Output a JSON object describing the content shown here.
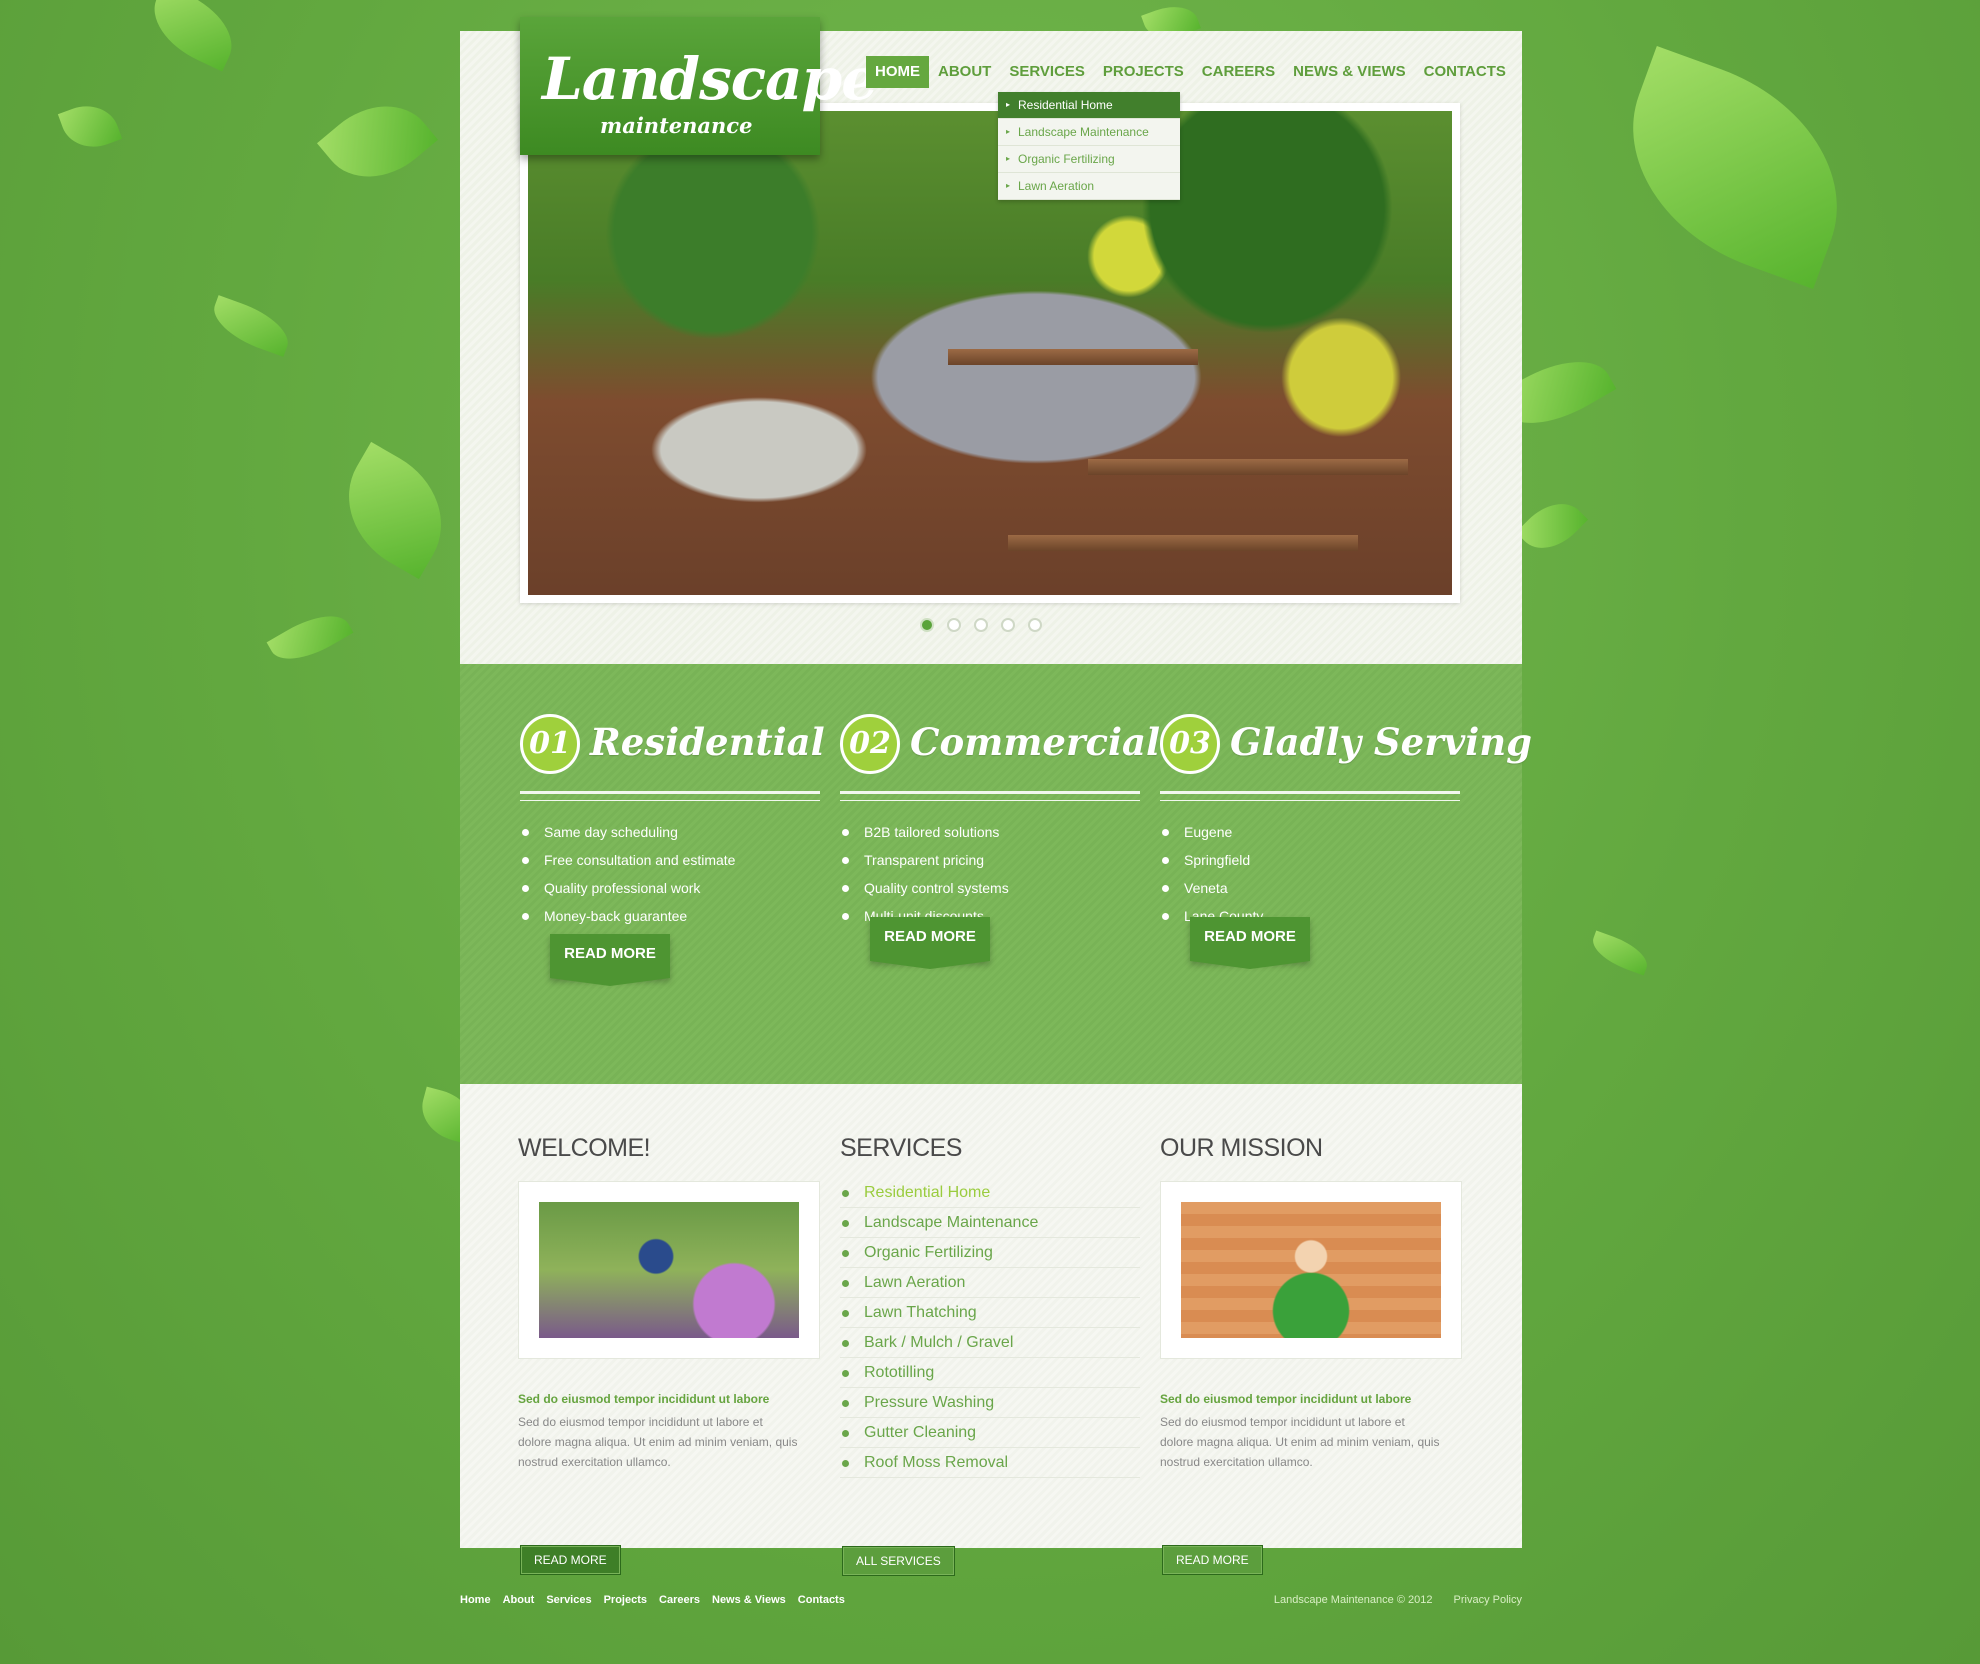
{
  "logo": {
    "line1": "Landscape",
    "line2": "maintenance"
  },
  "nav": [
    {
      "label": "HOME",
      "active": true
    },
    {
      "label": "ABOUT"
    },
    {
      "label": "SERVICES"
    },
    {
      "label": "PROJECTS"
    },
    {
      "label": "CAREERS"
    },
    {
      "label": "NEWS & VIEWS"
    },
    {
      "label": "CONTACTS"
    }
  ],
  "dropdown": [
    "Residential Home",
    "Landscape Maintenance",
    "Organic Fertilizing",
    "Lawn Aeration"
  ],
  "slider": {
    "slide_count": 5,
    "active_index": 0
  },
  "features": [
    {
      "num": "01",
      "title": "Residential",
      "items": [
        "Same day scheduling",
        "Free consultation and estimate",
        "Quality professional work",
        "Money-back guarantee"
      ],
      "button": "READ MORE"
    },
    {
      "num": "02",
      "title": "Commercial",
      "items": [
        "B2B tailored solutions",
        "Transparent pricing",
        "Quality control systems",
        "Multi-unit discounts"
      ],
      "button": "READ MORE"
    },
    {
      "num": "03",
      "title": "Gladly Serving",
      "items": [
        "Eugene",
        "Springfield",
        "Veneta",
        "Lane County"
      ],
      "button": "READ MORE"
    }
  ],
  "welcome": {
    "heading": "WELCOME!",
    "lead": "Sed do eiusmod tempor incididunt ut labore",
    "body": "Sed do eiusmod tempor incididunt ut labore et dolore magna aliqua. Ut enim ad minim veniam, quis nostrud exercitation ullamco.",
    "button": "READ MORE"
  },
  "services": {
    "heading": "SERVICES",
    "items": [
      "Residential Home",
      "Landscape Maintenance",
      "Organic Fertilizing",
      "Lawn Aeration",
      "Lawn Thatching",
      "Bark / Mulch / Gravel",
      "Rototilling",
      "Pressure Washing",
      "Gutter Cleaning",
      "Roof Moss Removal"
    ],
    "button": "ALL SERVICES"
  },
  "mission": {
    "heading": "OUR MISSION",
    "lead": "Sed do eiusmod tempor incididunt ut labore",
    "body": "Sed do eiusmod tempor incididunt ut labore et dolore magna aliqua. Ut enim ad minim veniam, quis nostrud exercitation ullamco.",
    "button": "READ MORE"
  },
  "footer": {
    "links": [
      "Home",
      "About",
      "Services",
      "Projects",
      "Careers",
      "News & Views",
      "Contacts"
    ],
    "copyright": "Landscape Maintenance © 2012",
    "privacy": "Privacy Policy"
  }
}
